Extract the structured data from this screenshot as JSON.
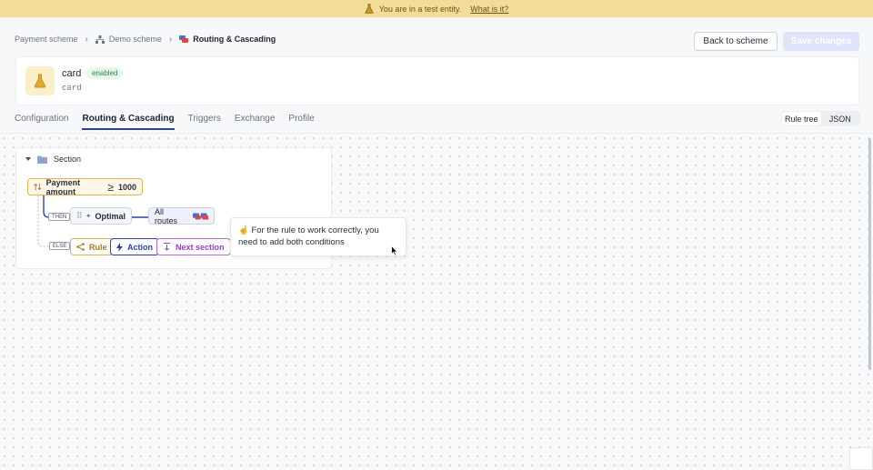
{
  "banner": {
    "message": "You are in a test entity.",
    "link": "What is it?"
  },
  "breadcrumb": {
    "items": [
      "Payment scheme",
      "Demo scheme",
      "Routing & Cascading"
    ]
  },
  "header": {
    "back_label": "Back to scheme",
    "save_label": "Save changes"
  },
  "entity": {
    "name": "card",
    "status": "enabled",
    "code": "card"
  },
  "tabs": [
    {
      "label": "Configuration"
    },
    {
      "label": "Routing & Cascading",
      "active": true
    },
    {
      "label": "Triggers"
    },
    {
      "label": "Exchange"
    },
    {
      "label": "Profile"
    }
  ],
  "view_toggle": {
    "options": [
      "Rule tree",
      "JSON"
    ],
    "selected": "Rule tree"
  },
  "tree": {
    "section_label": "Section",
    "condition": {
      "field": "Payment amount",
      "operator": "≥",
      "value": "1000"
    },
    "then_tag": "THEN",
    "else_tag": "ELSE",
    "strategy": "Optimal",
    "routes": "All routes",
    "buttons": {
      "rule": "Rule",
      "action": "Action",
      "next_section": "Next section"
    }
  },
  "tooltip": {
    "text": "☝️ For the rule to work correctly, you need to add both conditions"
  },
  "colors": {
    "banner_bg": "#f2dc9a",
    "accent": "#2b3fb0",
    "rule": "#e2b449",
    "next_section": "#9b3fc6",
    "enabled_badge": "#2f8a3f"
  }
}
